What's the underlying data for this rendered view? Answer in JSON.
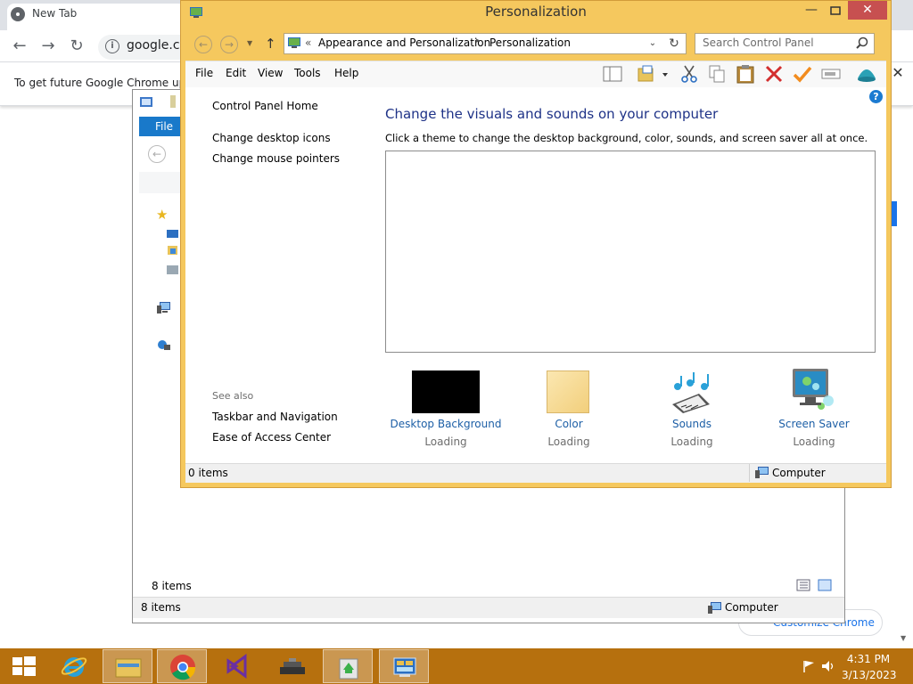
{
  "chrome": {
    "tab_title": "New Tab",
    "omnibox_text": "google.co",
    "signin_text": "To get future Google Chrome up",
    "customize_label": "Customize Chrome",
    "close_symbol": "✕",
    "back_symbol": "←",
    "forward_symbol": "→",
    "reload_symbol": "↻"
  },
  "explorer": {
    "file_tab": "File",
    "inner_status": "8 items",
    "status_items": "8 items",
    "status_computer": "Computer"
  },
  "personalization": {
    "title": "Personalization",
    "address": {
      "overflow": "«",
      "crumb1": "Appearance and Personalization",
      "separator": "▸",
      "crumb2": "Personalization"
    },
    "search_placeholder": "Search Control Panel",
    "menu": [
      "File",
      "Edit",
      "View",
      "Tools",
      "Help"
    ],
    "left_links": {
      "home": "Control Panel Home",
      "desktop_icons": "Change desktop icons",
      "mouse_pointers": "Change mouse pointers",
      "see_also": "See also",
      "taskbar": "Taskbar and Navigation",
      "ease": "Ease of Access Center"
    },
    "heading": "Change the visuals and sounds on your computer",
    "subheading": "Click a theme to change the desktop background, color, sounds, and screen saver all at once.",
    "bottom_items": [
      {
        "label": "Desktop Background",
        "status": "Loading"
      },
      {
        "label": "Color",
        "status": "Loading"
      },
      {
        "label": "Sounds",
        "status": "Loading"
      },
      {
        "label": "Screen Saver",
        "status": "Loading"
      }
    ],
    "status_items": "0 items",
    "status_computer": "Computer",
    "help_symbol": "?",
    "min_symbol": "—",
    "close_symbol": "✕"
  },
  "taskbar": {
    "time": "4:31 PM",
    "date": "3/13/2023"
  },
  "colors": {
    "window_frame": "#f5c85e",
    "taskbar": "#b6700e",
    "link": "#1d5fa6",
    "heading": "#1e3287",
    "close_button": "#c75050"
  }
}
